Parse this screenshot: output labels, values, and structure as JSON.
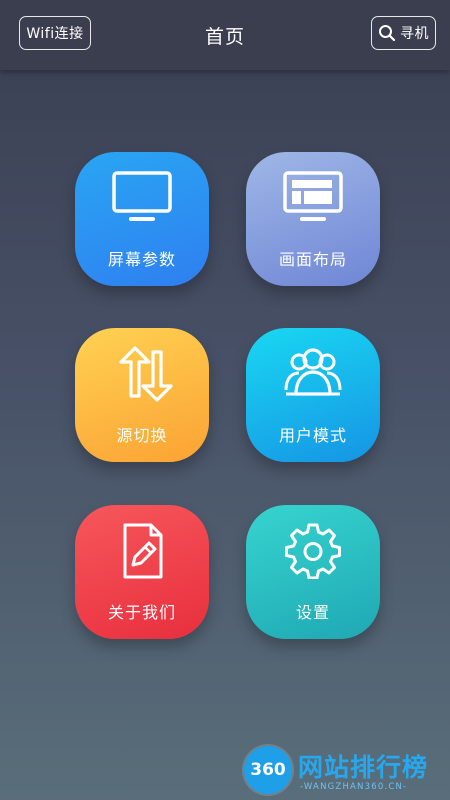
{
  "header": {
    "title": "首页",
    "wifi_button": "Wifi连接",
    "find_button": "寻机"
  },
  "menu": [
    {
      "label": "屏幕参数",
      "icon": "monitor-icon",
      "color": "#2f8ff2"
    },
    {
      "label": "画面布局",
      "icon": "layout-icon",
      "color": "#8aa0dd"
    },
    {
      "label": "源切换",
      "icon": "swap-icon",
      "color": "#fdb83f"
    },
    {
      "label": "用户模式",
      "icon": "users-icon",
      "color": "#18b6eb"
    },
    {
      "label": "关于我们",
      "icon": "document-edit-icon",
      "color": "#ef4249"
    },
    {
      "label": "设置",
      "icon": "gear-icon",
      "color": "#2bbec2"
    }
  ],
  "watermark": {
    "logo_text": "360",
    "site_name": "网站排行榜",
    "domain": "-WANGZHAN360.CN-"
  }
}
